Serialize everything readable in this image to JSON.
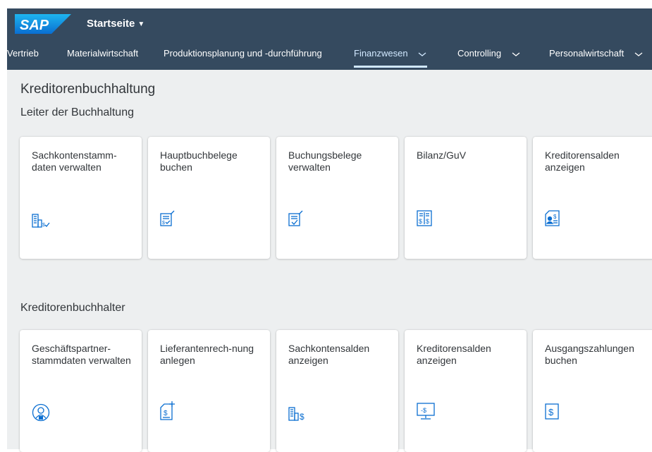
{
  "shell": {
    "logo_text": "SAP",
    "home_title": "Startseite",
    "home_caret": "▼",
    "nav": [
      {
        "label": "Vertrieb"
      },
      {
        "label": "Materialwirtschaft"
      },
      {
        "label": "Produktionsplanung und -durchführung"
      },
      {
        "label": "Finanzwesen",
        "active": true
      },
      {
        "label": "Controlling"
      },
      {
        "label": "Personalwirtschaft"
      }
    ]
  },
  "page": {
    "title": "Kreditorenbuchhaltung",
    "groups": [
      {
        "title": "Leiter der Buchhaltung",
        "tiles": [
          {
            "title": "Sachkontenstamm-daten verwalten",
            "icon": "ledger-building-icon"
          },
          {
            "title": "Hauptbuchbelege buchen",
            "icon": "post-document-icon"
          },
          {
            "title": "Buchungsbelege verwalten",
            "icon": "post-document-icon"
          },
          {
            "title": "Bilanz/GuV",
            "icon": "balance-sheet-icon"
          },
          {
            "title": "Kreditorensalden anzeigen",
            "icon": "supplier-balance-icon"
          }
        ]
      },
      {
        "title": "Kreditorenbuchhalter",
        "tiles": [
          {
            "title": "Geschäftspartner-stammdaten verwalten",
            "icon": "business-partner-icon"
          },
          {
            "title": "Lieferantenrech-nung anlegen",
            "icon": "create-invoice-icon"
          },
          {
            "title": "Sachkontensalden anzeigen",
            "icon": "gl-balance-icon"
          },
          {
            "title": "Kreditorensalden anzeigen",
            "icon": "monitor-balance-icon"
          },
          {
            "title": "Ausgangszahlungen buchen",
            "icon": "payment-document-icon"
          }
        ]
      }
    ]
  },
  "colors": {
    "shell": "#354a5f",
    "background": "#edeff0",
    "icon": "#0a6ed1",
    "logo": "#0a6ed1"
  }
}
